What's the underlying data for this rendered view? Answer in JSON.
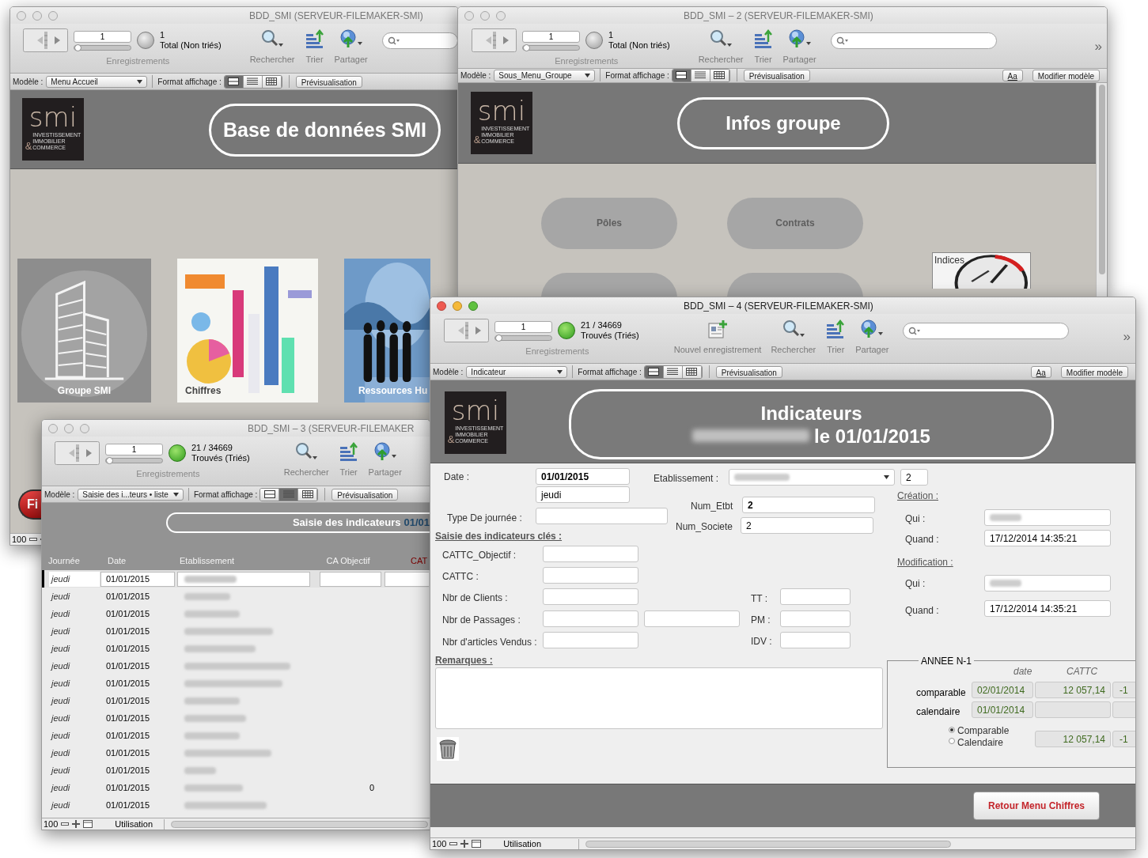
{
  "windows": [
    {
      "kind": "menu",
      "title": "BDD_SMI (SERVEUR-FILEMAKER-SMI)",
      "active": false,
      "toolbar": {
        "record": "1",
        "slider": {
          "level": 0
        },
        "found": false,
        "count": "1",
        "count_label": "Total (Non triés)",
        "records_label": "Enregistrements",
        "tools": [
          {
            "kind": "search",
            "label": "Rechercher"
          },
          {
            "kind": "sort",
            "label": "Trier"
          },
          {
            "kind": "share",
            "label": "Partager"
          }
        ],
        "search_field": true
      },
      "layout_bar": {
        "model_label": "Modèle :",
        "model": "Menu Accueil",
        "view_label": "Format affichage :",
        "views": [
          {
            "kind": "form",
            "selected": true
          },
          {
            "kind": "list",
            "selected": false
          },
          {
            "kind": "table",
            "selected": false
          }
        ],
        "preview": "Prévisualisation"
      },
      "logo": {
        "brand": "smi",
        "lines": [
          "INVESTISSEMENT",
          "IMMOBILIER",
          "COMMERCE"
        ],
        "amp": "&"
      },
      "heading": "Base de données SMI",
      "tiles": [
        {
          "label": "Groupe SMI"
        },
        {
          "label": "Chiffres"
        },
        {
          "label": "Ressources Hu"
        }
      ],
      "round_button": "Fi",
      "status_bar": {
        "zoom": "100"
      }
    },
    {
      "kind": "group",
      "title": "BDD_SMI – 2 (SERVEUR-FILEMAKER-SMI)",
      "active": false,
      "toolbar": {
        "record": "1",
        "slider": {
          "level": 0
        },
        "found": false,
        "count": "1",
        "count_label": "Total (Non triés)",
        "records_label": "Enregistrements",
        "tools": [
          {
            "kind": "search",
            "label": "Rechercher"
          },
          {
            "kind": "sort",
            "label": "Trier"
          },
          {
            "kind": "share",
            "label": "Partager"
          }
        ],
        "search_field": true,
        "overflow": "»"
      },
      "layout_bar": {
        "model_label": "Modèle :",
        "model": "Sous_Menu_Groupe",
        "view_label": "Format affichage :",
        "views": [
          {
            "kind": "form",
            "selected": true
          },
          {
            "kind": "list",
            "selected": false
          },
          {
            "kind": "table",
            "selected": false
          }
        ],
        "preview": "Prévisualisation",
        "buttons": [
          "Aa",
          "Modifier modèle"
        ]
      },
      "logo": {
        "brand": "smi",
        "lines": [
          "INVESTISSEMENT",
          "IMMOBILIER",
          "COMMERCE"
        ],
        "amp": "&"
      },
      "heading": "Infos groupe",
      "buttons": [
        {
          "kind": "labeled",
          "label": "Pôles"
        },
        {
          "kind": "labeled",
          "label": "Contrats"
        },
        {
          "kind": "plain"
        },
        {
          "kind": "plain"
        }
      ],
      "tile": {
        "label": "Indices"
      }
    },
    {
      "kind": "list",
      "title": "BDD_SMI – 3 (SERVEUR-FILEMAKER",
      "active": false,
      "toolbar": {
        "record": "1",
        "slider": {
          "level": 0
        },
        "found": true,
        "count": "21 / 34669",
        "count_label": "Trouvés (Triés)",
        "records_label": "Enregistrements",
        "tools": [
          {
            "kind": "search",
            "label": "Rechercher"
          },
          {
            "kind": "sort",
            "label": "Trier"
          },
          {
            "kind": "share",
            "label": "Partager"
          }
        ]
      },
      "layout_bar": {
        "model_label": "Modèle :",
        "model": "Saisie des i...teurs • liste",
        "view_label": "Format affichage :",
        "views": [
          {
            "kind": "form",
            "selected": false
          },
          {
            "kind": "list",
            "selected": true
          },
          {
            "kind": "table",
            "selected": false
          }
        ],
        "preview": "Prévisualisation"
      },
      "heading": "Saisie des indicateurs",
      "heading_date": "01/01",
      "columns": [
        {
          "kind": "plain",
          "label": "Journée"
        },
        {
          "kind": "plain",
          "label": "Date"
        },
        {
          "kind": "plain",
          "label": "Etablissement"
        },
        {
          "kind": "plain",
          "label": "CA Objectif"
        },
        {
          "kind": "warning",
          "label": "CAT"
        }
      ],
      "rows": [
        {
          "day": "jeudi",
          "date": "01/01/2015",
          "selected": true
        },
        {
          "day": "jeudi",
          "date": "01/01/2015",
          "selected": false
        },
        {
          "day": "jeudi",
          "date": "01/01/2015",
          "selected": false
        },
        {
          "day": "jeudi",
          "date": "01/01/2015",
          "selected": false
        },
        {
          "day": "jeudi",
          "date": "01/01/2015",
          "selected": false
        },
        {
          "day": "jeudi",
          "date": "01/01/2015",
          "selected": false
        },
        {
          "day": "jeudi",
          "date": "01/01/2015",
          "selected": false
        },
        {
          "day": "jeudi",
          "date": "01/01/2015",
          "selected": false
        },
        {
          "day": "jeudi",
          "date": "01/01/2015",
          "selected": false
        },
        {
          "day": "jeudi",
          "date": "01/01/2015",
          "selected": false
        },
        {
          "day": "jeudi",
          "date": "01/01/2015",
          "selected": false
        },
        {
          "day": "jeudi",
          "date": "01/01/2015",
          "selected": false
        },
        {
          "day": "jeudi",
          "date": "01/01/2015",
          "ca_objectif": "0",
          "selected": false
        },
        {
          "day": "jeudi",
          "date": "01/01/2015",
          "selected": false
        }
      ],
      "status_bar": {
        "zoom": "100",
        "mode": "Utilisation"
      }
    },
    {
      "kind": "form",
      "title": "BDD_SMI – 4 (SERVEUR-FILEMAKER-SMI)",
      "active": true,
      "toolbar": {
        "record": "1",
        "slider": {
          "level": 0
        },
        "found": true,
        "count": "21 / 34669",
        "count_label": "Trouvés (Triés)",
        "records_label": "Enregistrements",
        "tools": [
          {
            "kind": "new",
            "label": "Nouvel enregistrement"
          },
          {
            "kind": "search",
            "label": "Rechercher"
          },
          {
            "kind": "sort",
            "label": "Trier"
          },
          {
            "kind": "share",
            "label": "Partager"
          }
        ],
        "search_field": true,
        "overflow": "»"
      },
      "layout_bar": {
        "model_label": "Modèle :",
        "model": "Indicateur",
        "view_label": "Format affichage :",
        "views": [
          {
            "kind": "form",
            "selected": true
          },
          {
            "kind": "list",
            "selected": false
          },
          {
            "kind": "table",
            "selected": false
          }
        ],
        "preview": "Prévisualisation",
        "buttons": [
          "Aa",
          "Modifier modèle"
        ]
      },
      "logo": {
        "brand": "smi",
        "lines": [
          "INVESTISSEMENT",
          "IMMOBILIER",
          "COMMERCE"
        ],
        "amp": "&"
      },
      "heading": "Indicateurs",
      "subheading": "le 01/01/2015",
      "date": {
        "label": "Date :",
        "value": "01/01/2015",
        "day": "jeudi"
      },
      "etablissement": {
        "label": "Etablissement :",
        "number": "2"
      },
      "day_type": {
        "label": "Type De journée :"
      },
      "num_etbt": {
        "label": "Num_Etbt",
        "value": "2"
      },
      "num_societe": {
        "label": "Num_Societe",
        "value": "2"
      },
      "creation": {
        "title": "Création :",
        "who_label": "Qui :",
        "when_label": "Quand :",
        "when": "17/12/2014 14:35:21"
      },
      "modification": {
        "title": "Modification :",
        "who_label": "Qui :",
        "when_label": "Quand :",
        "when": "17/12/2014 14:35:21"
      },
      "section_title": "Saisie des indicateurs clés :",
      "indicators": [
        {
          "label": "CATTC_Objectif :"
        },
        {
          "label": "CATTC :"
        },
        {
          "label": "Nbr de Clients :",
          "side_label": "TT :"
        },
        {
          "label": "Nbr de Passages :",
          "extra_field": true,
          "side_label": "PM :"
        },
        {
          "label": "Nbr d'articles Vendus :",
          "side_label": "IDV :"
        }
      ],
      "remarks_label": "Remarques :",
      "previous_year": {
        "title": "ANNEE N-1",
        "col_date": "date",
        "col_cattc": "CATTC",
        "rows": [
          {
            "label": "comparable",
            "date": "02/01/2014",
            "cattc": "12 057,14",
            "column_3": "-1"
          },
          {
            "label": "calendaire",
            "date": "01/01/2014"
          }
        ],
        "options": [
          {
            "label": "Comparable",
            "selected": true
          },
          {
            "label": "Calendaire",
            "selected": false
          }
        ],
        "total": "12 057,14",
        "total_column_3": "-1"
      },
      "back_button": "Retour Menu Chiffres",
      "status_bar": {
        "zoom": "100",
        "mode": "Utilisation"
      }
    }
  ]
}
